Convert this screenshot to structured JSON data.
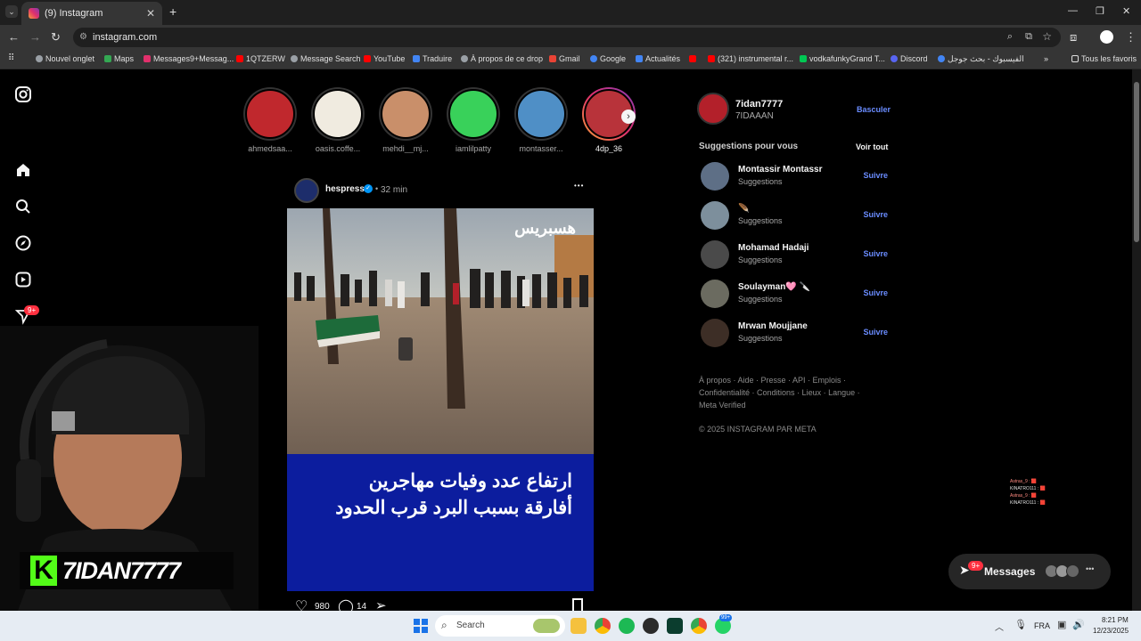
{
  "browser": {
    "tab_title": "(9) Instagram",
    "tab_close": "✕",
    "new_tab": "+",
    "url": "instagram.com",
    "window_controls": [
      "—",
      "❐",
      "✕"
    ],
    "bookmarks": [
      {
        "label": "Nouvel onglet",
        "color": "#9aa0a6"
      },
      {
        "label": "Maps",
        "color": "#34a853"
      },
      {
        "label": "Messages9+Messag...",
        "color": "#e1306c"
      },
      {
        "label": "1QTZERW",
        "color": "#ff0000"
      },
      {
        "label": "Message Search",
        "color": "#9aa0a6"
      },
      {
        "label": "YouTube",
        "color": "#ff0000"
      },
      {
        "label": "Traduire",
        "color": "#4285f4"
      },
      {
        "label": "À propos de ce drop",
        "color": "#9aa0a6"
      },
      {
        "label": "Gmail",
        "color": "#ea4335"
      },
      {
        "label": "Google",
        "color": "#4285f4"
      },
      {
        "label": "Actualités",
        "color": "#4285f4"
      },
      {
        "label": "",
        "color": "#ff0000"
      },
      {
        "label": "(321) instrumental r...",
        "color": "#ff0000"
      },
      {
        "label": "vodkafunkyGrand T...",
        "color": "#00c853"
      },
      {
        "label": "Discord",
        "color": "#5865f2"
      },
      {
        "label": "الفيسبوك - بحث جوجل",
        "color": "#4285f4"
      }
    ],
    "all_bookmarks": "Tous les favoris",
    "more_bookmarks": "»"
  },
  "sidebar": {
    "messages_badge": "9+"
  },
  "stories": [
    {
      "name": "ahmedsaa...",
      "seen": true,
      "color": "#c0282d"
    },
    {
      "name": "oasis.coffe...",
      "seen": true,
      "color": "#f0ebe0"
    },
    {
      "name": "mehdi__mj...",
      "seen": true,
      "color": "#c98f6a"
    },
    {
      "name": "iamlilpatty",
      "seen": true,
      "color": "#39d15a"
    },
    {
      "name": "montasser...",
      "seen": true,
      "color": "#4f8fc6"
    },
    {
      "name": "4dp_36",
      "seen": false,
      "color": "#b8333a"
    }
  ],
  "post": {
    "author": "hespress",
    "verified": "✓",
    "separator": "•",
    "time": "32 min",
    "more": "•••",
    "watermark": "هسبريس",
    "headline_line1": "ارتفاع عدد وفيات مهاجرين",
    "headline_line2": "أفارقة بسبب البرد قرب الحدود",
    "likes": "980",
    "comments": "14"
  },
  "account": {
    "username": "7idan7777",
    "display_name": "7IDAAAN",
    "switch_label": "Basculer"
  },
  "suggestions": {
    "title": "Suggestions pour vous",
    "see_all": "Voir tout",
    "items": [
      {
        "name": "Montassir Montassr",
        "sub": "Suggestions",
        "action": "Suivre"
      },
      {
        "name": "🪶",
        "sub": "Suggestions",
        "action": "Suivre"
      },
      {
        "name": "Mohamad Hadaji",
        "sub": "Suggestions",
        "action": "Suivre"
      },
      {
        "name": "Soulayman🩷 🔪",
        "sub": "Suggestions",
        "action": "Suivre"
      },
      {
        "name": "Mrwan Moujjane",
        "sub": "Suggestions",
        "action": "Suivre"
      }
    ]
  },
  "footer": {
    "links": "À propos · Aide · Presse · API · Emplois · Confidentialité · Conditions · Lieux · Langue · Meta Verified",
    "copyright": "© 2025 INSTAGRAM PAR META"
  },
  "messages_bar": {
    "label": "Messages",
    "badge": "9+"
  },
  "chat_overlay": [
    "Astras_9 : 🟥",
    "KINATRO111 : 🟥",
    "Astras_9 : 🟥",
    "KINATRO111 : 🟥"
  ],
  "streamer": {
    "name": "7IDAN7777",
    "logo_letter": "K"
  },
  "taskbar": {
    "search_placeholder": "Search",
    "lang": "FRA",
    "time": "8:21 PM",
    "date": "12/23/2025",
    "whatsapp_badge": "99+"
  }
}
